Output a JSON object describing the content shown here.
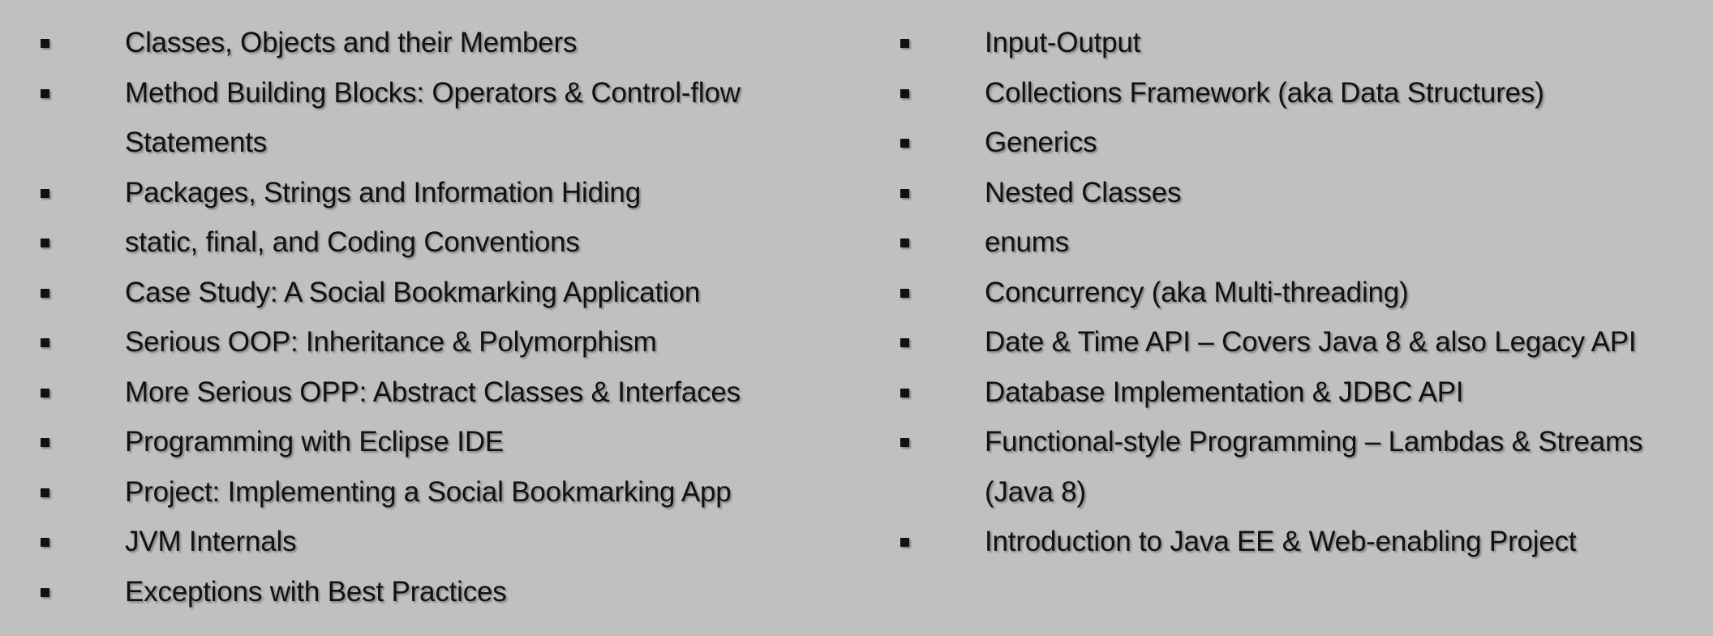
{
  "left_column": [
    "Classes, Objects and their Members",
    "Method Building Blocks: Operators & Control-flow Statements",
    "Packages, Strings and Information Hiding",
    "static, final, and Coding Conventions",
    "Case Study: A Social Bookmarking Application",
    "Serious OOP: Inheritance & Polymorphism",
    "More Serious OPP: Abstract Classes & Interfaces",
    "Programming with Eclipse IDE",
    "Project: Implementing a Social Bookmarking App",
    "JVM Internals",
    "Exceptions with Best Practices"
  ],
  "right_column": [
    "Input-Output",
    "Collections Framework (aka Data Structures)",
    "Generics",
    "Nested Classes",
    "enums",
    "Concurrency (aka Multi-threading)",
    "Date & Time API – Covers Java 8 & also Legacy API",
    "Database Implementation & JDBC API",
    "Functional-style Programming – Lambdas & Streams (Java 8)",
    "Introduction to Java EE & Web-enabling Project"
  ],
  "bullet_icon": "square-bullet-icon",
  "colors": {
    "background": "#c0c0c0",
    "text": "#111111"
  }
}
